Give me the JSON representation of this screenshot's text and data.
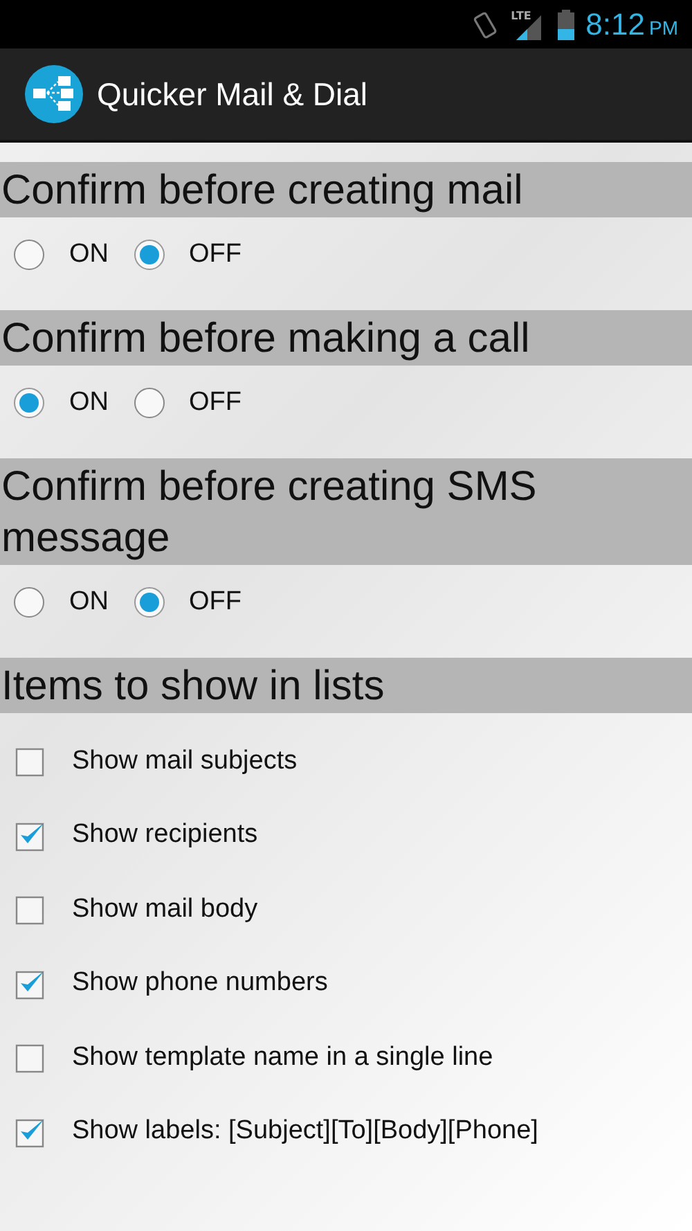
{
  "status_bar": {
    "network": "LTE",
    "time": "8:12",
    "ampm": "PM"
  },
  "action_bar": {
    "title": "Quicker Mail & Dial"
  },
  "sections": [
    {
      "title": "Confirm before creating mail",
      "kind": "radio",
      "options": [
        {
          "label": "ON",
          "selected": false
        },
        {
          "label": "OFF",
          "selected": true
        }
      ]
    },
    {
      "title": "Confirm before making a call",
      "kind": "radio",
      "options": [
        {
          "label": "ON",
          "selected": true
        },
        {
          "label": "OFF",
          "selected": false
        }
      ]
    },
    {
      "title": "Confirm before creating SMS message",
      "kind": "radio",
      "options": [
        {
          "label": "ON",
          "selected": false
        },
        {
          "label": "OFF",
          "selected": true
        }
      ]
    },
    {
      "title": "Items to show in lists",
      "kind": "checkbox",
      "items": [
        {
          "label": "Show mail subjects",
          "checked": false
        },
        {
          "label": "Show recipients",
          "checked": true
        },
        {
          "label": "Show mail body",
          "checked": false
        },
        {
          "label": "Show phone numbers",
          "checked": true
        },
        {
          "label": "Show template name in a single line",
          "checked": false
        },
        {
          "label": "Show labels: [Subject][To][Body][Phone]",
          "checked": true
        }
      ]
    }
  ]
}
